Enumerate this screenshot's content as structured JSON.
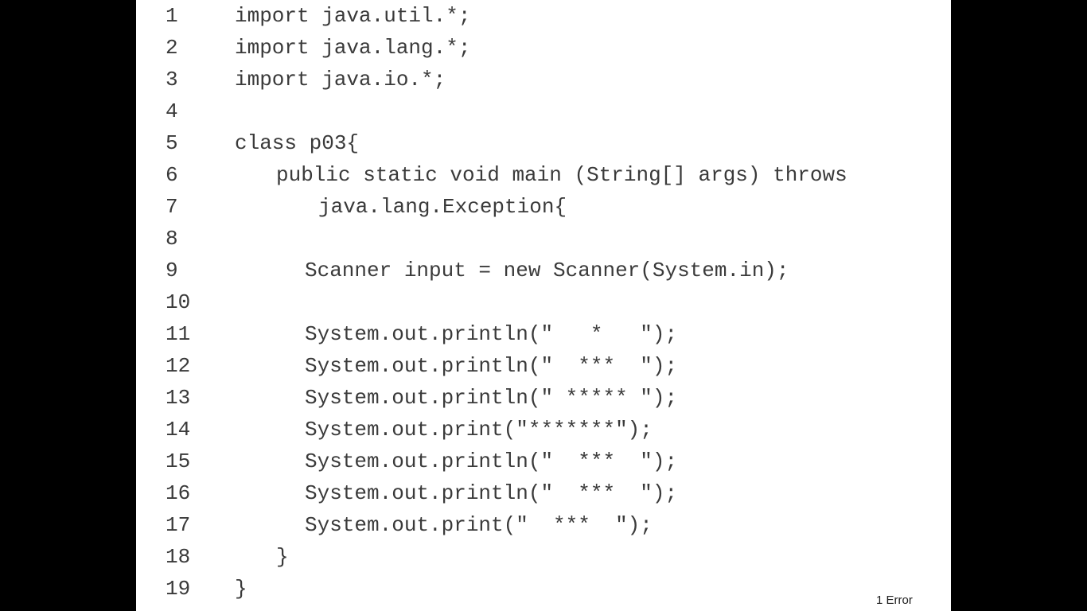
{
  "code_lines": [
    {
      "num": "1",
      "text": "import java.util.*;"
    },
    {
      "num": "2",
      "text": "import java.lang.*;"
    },
    {
      "num": "3",
      "text": "import java.io.*;"
    },
    {
      "num": "4",
      "text": ""
    },
    {
      "num": "5",
      "text": "class p03{"
    },
    {
      "num": "6",
      "text": "public static void main (String[] args) throws"
    },
    {
      "num": "7",
      "text": "java.lang.Exception{"
    },
    {
      "num": "8",
      "text": ""
    },
    {
      "num": "9",
      "text": "Scanner input = new Scanner(System.in);"
    },
    {
      "num": "10",
      "text": ""
    },
    {
      "num": "11",
      "text": "System.out.println(\"   *   \");"
    },
    {
      "num": "12",
      "text": "System.out.println(\"  ***  \");"
    },
    {
      "num": "13",
      "text": "System.out.println(\" ***** \");"
    },
    {
      "num": "14",
      "text": "System.out.print(\"*******\");"
    },
    {
      "num": "15",
      "text": "System.out.println(\"  ***  \");"
    },
    {
      "num": "16",
      "text": "System.out.println(\"  ***  \");"
    },
    {
      "num": "17",
      "text": "System.out.print(\"  ***  \");"
    },
    {
      "num": "18",
      "text": "}"
    },
    {
      "num": "19",
      "text": "}"
    }
  ],
  "status": {
    "error_count": "1 Error"
  }
}
